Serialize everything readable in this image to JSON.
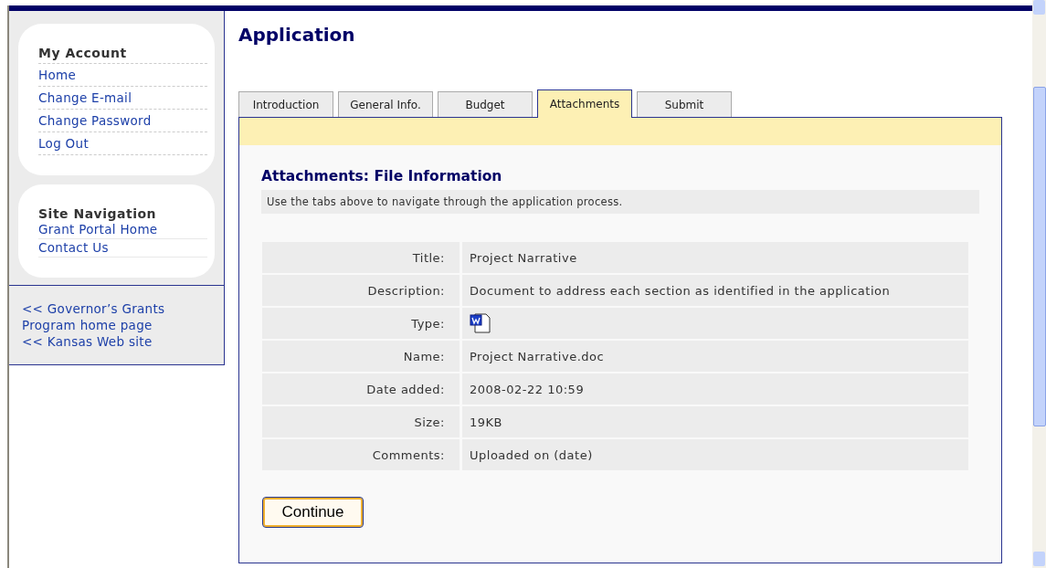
{
  "sidebar": {
    "account": {
      "heading": "My Account",
      "links": [
        "Home",
        "Change E-mail",
        "Change Password",
        "Log Out"
      ]
    },
    "navigation": {
      "heading": "Site Navigation",
      "links": [
        "Grant Portal Home",
        "Contact Us"
      ]
    },
    "footer_links": [
      "<< Governor’s Grants Program home page",
      "<< Kansas Web site"
    ]
  },
  "page": {
    "title": "Application"
  },
  "tabs": [
    {
      "label": "Introduction",
      "selected": false
    },
    {
      "label": "General Info.",
      "selected": false
    },
    {
      "label": "Budget",
      "selected": false
    },
    {
      "label": "Attachments",
      "selected": true
    },
    {
      "label": "Submit",
      "selected": false
    }
  ],
  "section": {
    "heading": "Attachments: File Information",
    "hint": "Use the tabs above to navigate through the application process."
  },
  "details": [
    {
      "label": "Title:",
      "kind": "text",
      "value": "Project Narrative"
    },
    {
      "label": "Description:",
      "kind": "text",
      "value": "Document to address each section as identified in the application"
    },
    {
      "label": "Type:",
      "kind": "word-doc"
    },
    {
      "label": "Name:",
      "kind": "text",
      "value": "Project Narrative.doc"
    },
    {
      "label": "Date added:",
      "kind": "text",
      "value": "2008-02-22 10:59"
    },
    {
      "label": "Size:",
      "kind": "text",
      "value": "19KB"
    },
    {
      "label": "Comments:",
      "kind": "text",
      "value": "Uploaded on (date)"
    }
  ],
  "buttons": [
    "Continue"
  ]
}
